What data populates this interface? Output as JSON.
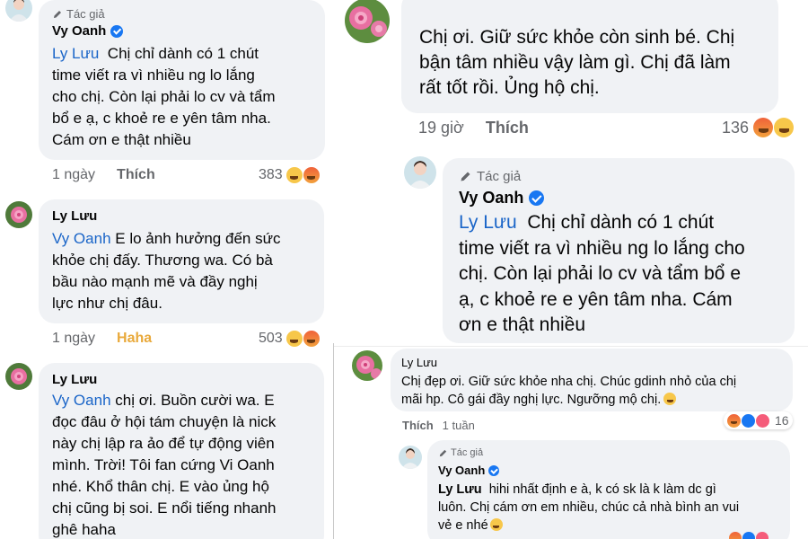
{
  "left": {
    "c1": {
      "badge": "Tác giả",
      "name": "Vy Oanh",
      "mention": "Ly Lưu",
      "lines": [
        "Chị chỉ dành có 1 chút",
        "time viết ra vì nhiều ng lo lắng",
        "cho chị. Còn lại phải lo cv và tẩm",
        "bổ e ạ, c khoẻ re e yên tâm nha.",
        "Cám ơn e thật nhiều"
      ],
      "time": "1 ngày",
      "action": "Thích",
      "count": "383"
    },
    "c2": {
      "name": "Ly Lưu",
      "mention": "Vy Oanh",
      "lines": [
        "E lo ảnh hưởng đến sức",
        "khỏe chị đấy. Thương wa. Có bà",
        "bầu nào mạnh mẽ và đầy nghị",
        "lực như chị đâu."
      ],
      "time": "1 ngày",
      "action": "Haha",
      "count": "503"
    },
    "c3": {
      "name": "Ly Lưu",
      "mention": "Vy Oanh",
      "lines": [
        "chị ơi. Buồn cười wa. E",
        "đọc đâu ở hội tám chuyện là nick",
        "này chị lập ra ảo để tự động viên",
        "mình. Trời! Tôi fan cứng Vi Oanh",
        "nhé. Khổ thân chị. E vào ủng hộ",
        "chị cũng bị soi. E nổi tiếng nhanh",
        "ghê haha"
      ]
    }
  },
  "right_top": {
    "c1": {
      "lines": [
        "Chị ơi. Giữ sức khỏe còn sinh bé. Chị",
        "bận tâm nhiều vậy làm gì. Chị đã làm",
        "rất tốt rồi. Ủng hộ chị."
      ],
      "time": "19 giờ",
      "action": "Thích",
      "count": "136"
    },
    "c2": {
      "badge": "Tác giả",
      "name": "Vy Oanh",
      "mention": "Ly Lưu",
      "lines": [
        "Chị chỉ dành có 1 chút",
        "time viết ra vì nhiều ng lo lắng cho",
        "chị. Còn lại phải lo cv và tẩm bổ e",
        "ạ, c khoẻ re e yên tâm nha. Cám",
        "ơn e thật nhiều"
      ]
    }
  },
  "right_bottom": {
    "c1": {
      "name": "Ly Lưu",
      "lines": [
        "Chị đẹp ơi. Giữ sức khỏe nha chị. Chúc gdinh nhỏ của chị",
        "mãi hp. Cô gái đầy nghị lực. Ngưỡng mộ chị."
      ],
      "action": "Thích",
      "time": "1 tuần",
      "count": "16"
    },
    "c2": {
      "badge": "Tác giả",
      "name": "Vy Oanh",
      "mention": "Ly Lưu",
      "lines": [
        "hihi nhất định e à, k có sk là k làm dc gì",
        "luôn. Chị cám ơn em nhiều, chúc cả nhà bình an vui",
        "vẻ e nhé"
      ]
    }
  },
  "colors": {
    "bubble": "#f0f2f5",
    "mention": "#1a65c8",
    "meta": "#65676b",
    "haha": "#e9a93b",
    "verified": "#1877f2"
  }
}
